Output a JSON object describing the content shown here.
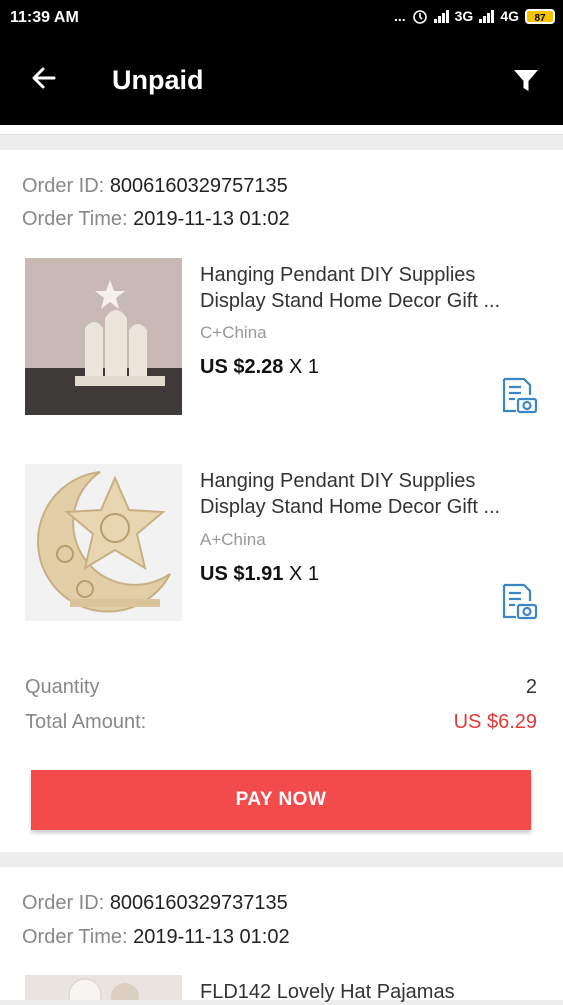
{
  "status_bar": {
    "time": "11:39 AM",
    "dots": "...",
    "net1": "3G",
    "net2": "4G",
    "battery": "87"
  },
  "header": {
    "title": "Unpaid"
  },
  "orders": [
    {
      "id_label": "Order ID:",
      "id": "8006160329757135",
      "time_label": "Order Time:",
      "time": "2019-11-13 01:02",
      "items": [
        {
          "title_line1": "Hanging Pendant DIY Supplies",
          "title_line2": "Display Stand Home Decor Gift ...",
          "sku": "C+China",
          "price": "US $2.28",
          "qty": "X 1"
        },
        {
          "title_line1": "Hanging Pendant DIY Supplies",
          "title_line2": "Display Stand Home Decor Gift ...",
          "sku": "A+China",
          "price": "US $1.91",
          "qty": "X 1"
        }
      ],
      "quantity_label": "Quantity",
      "quantity": "2",
      "total_label": "Total Amount:",
      "total": "US $6.29",
      "pay_label": "PAY NOW"
    },
    {
      "id_label": "Order ID:",
      "id": "8006160329737135",
      "time_label": "Order Time:",
      "time": "2019-11-13 01:02",
      "items": [
        {
          "title_line1": "FLD142 Lovely Hat Pajamas"
        }
      ]
    }
  ],
  "colors": {
    "accent": "#f34a4c",
    "total": "#e8393a",
    "icon": "#3a86c8"
  }
}
